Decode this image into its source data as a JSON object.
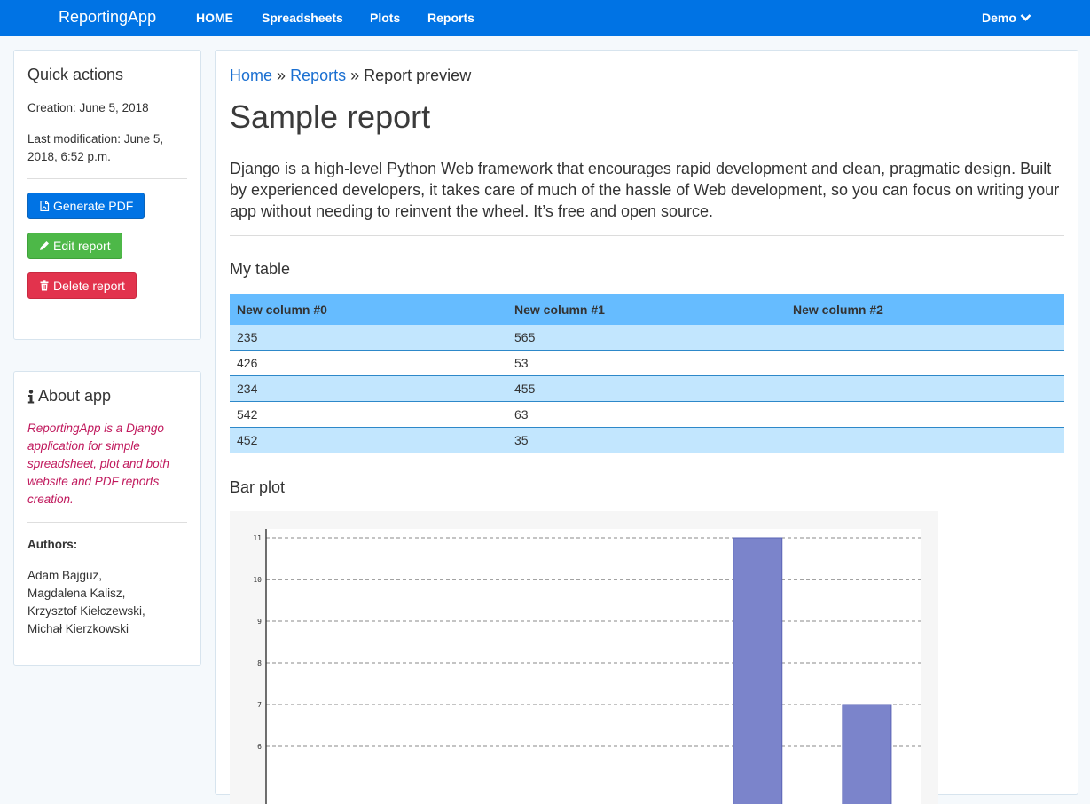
{
  "navbar": {
    "brand": "ReportingApp",
    "links": [
      "HOME",
      "Spreadsheets",
      "Plots",
      "Reports"
    ],
    "user": "Demo",
    "bg_color": "#0073e4"
  },
  "quick_actions": {
    "title": "Quick actions",
    "creation": "Creation: June 5, 2018",
    "modification": "Last modification: June 5, 2018, 6:52 p.m.",
    "buttons": {
      "generate_pdf": "Generate PDF",
      "edit": "Edit report",
      "delete": "Delete report"
    },
    "colors": {
      "pdf": "#0073e4",
      "edit": "#4db848",
      "delete": "#e2334d"
    }
  },
  "about": {
    "title": "About app",
    "description": "ReportingApp is a Django application for simple spreadsheet, plot and both website and PDF reports creation.",
    "authors_label": "Authors:",
    "authors": [
      "Adam Bajguz,",
      "Magdalena Kalisz,",
      "Krzysztof Kiełczewski,",
      "Michał Kierzkowski"
    ]
  },
  "breadcrumb": {
    "home": "Home",
    "sep1": "»",
    "reports": "Reports",
    "sep2": "»",
    "current": "Report preview"
  },
  "report": {
    "title": "Sample report",
    "intro": "Django is a high-level Python Web framework that encourages rapid development and clean, pragmatic design. Built by experienced developers, it takes care of much of the hassle of Web development, so you can focus on writing your app without needing to reinvent the wheel. It’s free and open source."
  },
  "table": {
    "title": "My table",
    "columns": [
      "New column #0",
      "New column #1",
      "New column #2"
    ],
    "rows": [
      [
        "235",
        "565",
        ""
      ],
      [
        "426",
        "53",
        ""
      ],
      [
        "234",
        "455",
        ""
      ],
      [
        "542",
        "63",
        ""
      ],
      [
        "452",
        "35",
        ""
      ]
    ]
  },
  "plot": {
    "title": "Bar plot"
  },
  "chart_data": {
    "type": "bar",
    "title": "",
    "xlabel": "",
    "ylabel": "",
    "yticks": [
      6,
      7,
      8,
      9,
      10,
      11
    ],
    "ylim_visible": [
      5,
      11.2
    ],
    "bars": [
      {
        "value": 11,
        "slot": 4
      },
      {
        "value": 7,
        "slot": 5
      }
    ],
    "slot_count": 6,
    "bar_color": "#7b84cb",
    "grid": true
  }
}
